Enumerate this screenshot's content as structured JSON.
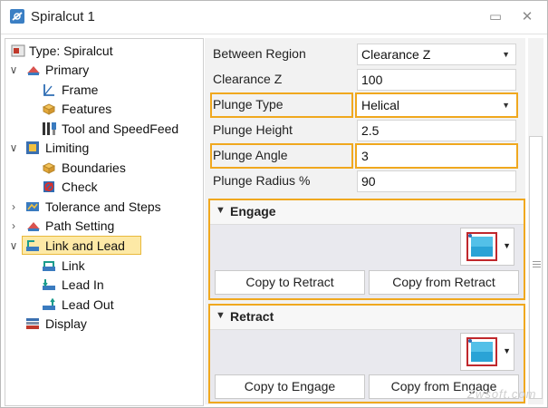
{
  "window": {
    "title": "Spiralcut 1",
    "pin_glyph": "▭",
    "close_glyph": "✕"
  },
  "tree": {
    "items": [
      {
        "label": "Type: Spiralcut",
        "icon": "type-icon"
      },
      {
        "label": "Primary",
        "icon": "primary-icon",
        "chevron": "∨"
      },
      {
        "label": "Frame",
        "icon": "frame-icon"
      },
      {
        "label": "Features",
        "icon": "features-icon"
      },
      {
        "label": "Tool and SpeedFeed",
        "icon": "tool-icon"
      },
      {
        "label": "Limiting",
        "icon": "limiting-icon",
        "chevron": "∨"
      },
      {
        "label": "Boundaries",
        "icon": "boundaries-icon"
      },
      {
        "label": "Check",
        "icon": "check-icon"
      },
      {
        "label": "Tolerance and Steps",
        "icon": "tolerance-icon",
        "chevron": "›"
      },
      {
        "label": "Path Setting",
        "icon": "path-setting-icon",
        "chevron": "›"
      },
      {
        "label": "Link and Lead",
        "icon": "link-lead-icon",
        "chevron": "∨",
        "selected": true
      },
      {
        "label": "Link",
        "icon": "link-icon"
      },
      {
        "label": "Lead In",
        "icon": "lead-in-icon"
      },
      {
        "label": "Lead Out",
        "icon": "lead-out-icon"
      },
      {
        "label": "Display",
        "icon": "display-icon"
      }
    ]
  },
  "params": [
    {
      "label": "Between Region",
      "value": "Clearance Z",
      "dropdown": true
    },
    {
      "label": "Clearance Z",
      "value": "100"
    },
    {
      "label": "Plunge Type",
      "value": "Helical",
      "dropdown": true,
      "highlighted": true
    },
    {
      "label": "Plunge Height",
      "value": "2.5"
    },
    {
      "label": "Plunge Angle",
      "value": "3",
      "highlighted": true
    },
    {
      "label": "Plunge Radius %",
      "value": "90"
    }
  ],
  "engage": {
    "title": "Engage",
    "copy_left": "Copy to Retract",
    "copy_right": "Copy from Retract"
  },
  "retract": {
    "title": "Retract",
    "copy_left": "Copy to Engage",
    "copy_right": "Copy from Engage"
  },
  "colors": {
    "highlight": "#f0a81e",
    "selected_bg": "#fde9a6",
    "color_swatch_border": "#c0282d",
    "color_swatch_fill": "#2aa3d6"
  },
  "watermark": "Zwsoft.com"
}
